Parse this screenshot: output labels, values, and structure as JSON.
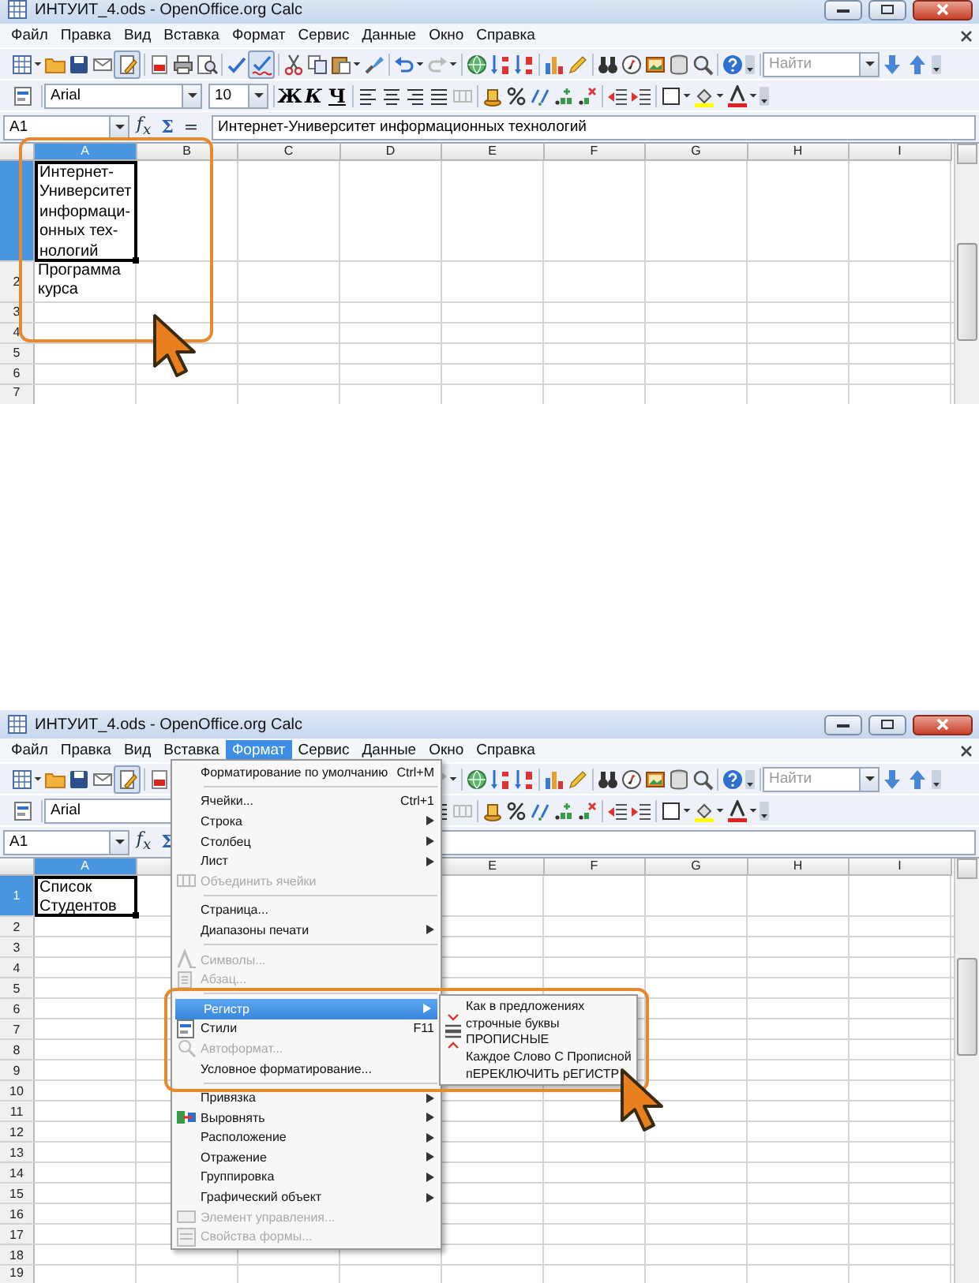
{
  "screenshots": [
    {
      "title": "ИНТУИТ_4.ods - OpenOffice.org Calc",
      "menu": [
        {
          "label": "Файл",
          "selected": false
        },
        {
          "label": "Правка",
          "selected": false
        },
        {
          "label": "Вид",
          "selected": false
        },
        {
          "label": "Вставка",
          "selected": false
        },
        {
          "label": "Формат",
          "selected": false
        },
        {
          "label": "Сервис",
          "selected": false
        },
        {
          "label": "Данные",
          "selected": false
        },
        {
          "label": "Окно",
          "selected": false
        },
        {
          "label": "Справка",
          "selected": false
        }
      ],
      "find_placeholder": "Найти",
      "font_name": "Arial",
      "font_size": "10",
      "format_buttons": [
        "Ж",
        "К",
        "Ч"
      ],
      "cell_ref": "A1",
      "formula_buttons": [
        "f$_{x}$",
        "Σ",
        "="
      ],
      "formula": "Интернет-Университет информационных технологий",
      "columns": [
        {
          "label": "A",
          "selected": true
        },
        {
          "label": "B",
          "selected": false
        },
        {
          "label": "C",
          "selected": false
        },
        {
          "label": "D",
          "selected": false
        },
        {
          "label": "E",
          "selected": false
        },
        {
          "label": "F",
          "selected": false
        },
        {
          "label": "G",
          "selected": false
        },
        {
          "label": "H",
          "selected": false
        },
        {
          "label": "I",
          "selected": false
        }
      ],
      "rows": [
        {
          "selected": true,
          "cell": "Интернет-\nУниверситет\nинформаци-\nонных тех-\nнологий"
        },
        {
          "label": "2",
          "selected": false,
          "cell": "Программа\nкурса"
        },
        {
          "label": "3",
          "selected": false
        },
        {
          "label": "4",
          "selected": false
        },
        {
          "label": "5",
          "selected": false
        },
        {
          "label": "6",
          "selected": false
        },
        {
          "label": "7",
          "selected": false
        }
      ]
    },
    {
      "title": "ИНТУИТ_4.ods - OpenOffice.org Calc",
      "menu": [
        {
          "label": "Файл",
          "selected": false
        },
        {
          "label": "Правка",
          "selected": false
        },
        {
          "label": "Вид",
          "selected": false
        },
        {
          "label": "Вставка",
          "selected": false
        },
        {
          "label": "Формат",
          "selected": true
        },
        {
          "label": "Сервис",
          "selected": false
        },
        {
          "label": "Данные",
          "selected": false
        },
        {
          "label": "Окно",
          "selected": false
        },
        {
          "label": "Справка",
          "selected": false
        }
      ],
      "find_placeholder": "Найти",
      "font_name": "Arial",
      "cell_ref": "A1",
      "formula_buttons": [
        "f$_{x}$",
        "Σ"
      ],
      "columns": [
        {
          "label": "A",
          "selected": true
        },
        {
          "selected": false
        },
        {},
        {},
        {
          "label": "E",
          "selected": false
        },
        {
          "label": "F",
          "selected": false
        },
        {
          "label": "G",
          "selected": false
        },
        {
          "label": "H",
          "selected": false
        },
        {
          "label": "I",
          "selected": false
        }
      ],
      "rows": [
        {
          "label": "1",
          "selected": true,
          "cell": "Список\nСтудентов"
        },
        {
          "label": "2",
          "selected": false
        },
        {
          "label": "3",
          "selected": false
        },
        {
          "label": "4",
          "selected": false
        },
        {
          "label": "5",
          "selected": false
        },
        {
          "label": "6",
          "selected": false
        },
        {
          "label": "7",
          "selected": false
        },
        {
          "label": "8",
          "selected": false
        },
        {
          "label": "9",
          "selected": false
        },
        {
          "label": "10",
          "selected": false
        },
        {
          "label": "11",
          "selected": false
        },
        {
          "label": "12",
          "selected": false
        },
        {
          "label": "13",
          "selected": false
        },
        {
          "label": "14",
          "selected": false
        },
        {
          "label": "15",
          "selected": false
        },
        {
          "label": "16",
          "selected": false
        },
        {
          "label": "17",
          "selected": false
        },
        {
          "label": "18",
          "selected": false
        },
        {
          "label": "19",
          "selected": false
        }
      ],
      "dropdown": [
        {
          "kind": "item",
          "label": "Форматирование по умолчанию",
          "shortcut": "Ctrl+M",
          "submenu": false,
          "disabled": false,
          "selected": false
        },
        {
          "kind": "separator"
        },
        {
          "kind": "item",
          "label": "Ячейки...",
          "shortcut": "Ctrl+1",
          "submenu": false,
          "disabled": false,
          "selected": false
        },
        {
          "kind": "item",
          "label": "Строка",
          "submenu": true,
          "disabled": false,
          "selected": false
        },
        {
          "kind": "item",
          "label": "Столбец",
          "submenu": true,
          "disabled": false,
          "selected": false
        },
        {
          "kind": "item",
          "label": "Лист",
          "submenu": true,
          "disabled": false,
          "selected": false
        },
        {
          "kind": "item",
          "label": "Объединить ячейки",
          "submenu": false,
          "disabled": true,
          "selected": false
        },
        {
          "kind": "separator"
        },
        {
          "kind": "item",
          "label": "Страница...",
          "submenu": false,
          "disabled": false,
          "selected": false
        },
        {
          "kind": "item",
          "label": "Диапазоны печати",
          "submenu": true,
          "disabled": false,
          "selected": false
        },
        {
          "kind": "separator"
        },
        {
          "kind": "item",
          "label": "Символы...",
          "submenu": false,
          "disabled": true,
          "selected": false
        },
        {
          "kind": "item",
          "label": "Абзац...",
          "submenu": false,
          "disabled": true,
          "selected": false
        },
        {
          "kind": "separator"
        },
        {
          "kind": "item",
          "label": "Регистр",
          "submenu": true,
          "disabled": false,
          "selected": true
        },
        {
          "kind": "item",
          "label": "Стили",
          "shortcut": "F11",
          "submenu": false,
          "disabled": false,
          "selected": false
        },
        {
          "kind": "item",
          "label": "Автоформат...",
          "submenu": false,
          "disabled": true,
          "selected": false
        },
        {
          "kind": "item",
          "label": "Условное форматирование...",
          "submenu": false,
          "disabled": false,
          "selected": false
        },
        {
          "kind": "separator"
        },
        {
          "kind": "item",
          "label": "Привязка",
          "submenu": true,
          "disabled": false,
          "selected": false
        },
        {
          "kind": "item",
          "label": "Выровнять",
          "submenu": true,
          "disabled": false,
          "selected": false
        },
        {
          "kind": "item",
          "label": "Расположение",
          "submenu": true,
          "disabled": false,
          "selected": false
        },
        {
          "kind": "item",
          "label": "Отражение",
          "submenu": true,
          "disabled": false,
          "selected": false
        },
        {
          "kind": "item",
          "label": "Группировка",
          "submenu": true,
          "disabled": false,
          "selected": false
        },
        {
          "kind": "item",
          "label": "Графический объект",
          "submenu": true,
          "disabled": false,
          "selected": false
        },
        {
          "kind": "item",
          "label": "Элемент управления...",
          "submenu": false,
          "disabled": true,
          "selected": false
        },
        {
          "kind": "item",
          "label": "Свойства формы...",
          "submenu": false,
          "disabled": true,
          "selected": false
        }
      ],
      "submenu": [
        {
          "label": "Как в предложениях"
        },
        {
          "label": "строчные буквы"
        },
        {
          "label": "ПРОПИСНЫЕ"
        },
        {
          "label": "Каждое Слово С Прописной"
        },
        {
          "label": "пЕРЕКЛЮЧИТЬ рЕГИСТР"
        }
      ]
    }
  ]
}
